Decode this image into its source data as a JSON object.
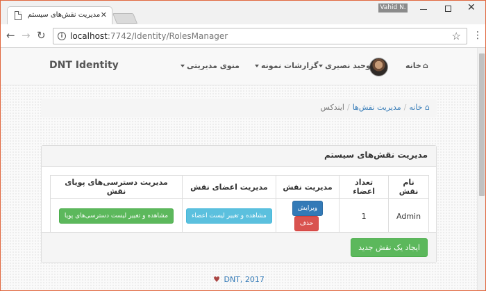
{
  "browser": {
    "tab_title": "مدیریت نقش‌های سیستم",
    "user_badge": "Vahid N.",
    "url_host": "localhost",
    "url_rest": ":7742/Identity/RolesManager"
  },
  "navbar": {
    "brand": "DNT Identity",
    "home": "خانه",
    "user_name": "وحید نصیری",
    "reports": "گزارشات نمونه",
    "admin_menu": "منوی مدیریتی"
  },
  "breadcrumb": {
    "home": "خانه",
    "roles": "مدیریت نقش‌ها",
    "current": "ایندکس"
  },
  "panel": {
    "title": "مدیریت نقش‌های سیستم",
    "new_role_button": "ایجاد یک نقش جدید"
  },
  "table": {
    "headers": [
      "نام نقش",
      "تعداد اعضاء",
      "مدیریت نقش",
      "مدیریت اعضای نقش",
      "مدیریت دسترسی‌های پویای نقش"
    ],
    "rows": [
      {
        "name": "Admin",
        "members": "1",
        "edit": "ویرایش",
        "delete": "حذف",
        "members_button": "مشاهده و تغییر لیست اعضاء",
        "access_button": "مشاهده و تغییر لیست دسترسی‌های پویا"
      }
    ]
  },
  "footer": {
    "text": "DNT, 2017"
  },
  "colors": {
    "window_border": "#e0663d",
    "link": "#337ab7",
    "primary": "#337ab7",
    "danger": "#d9534f",
    "info": "#5bc0de",
    "success": "#5cb85c",
    "heart": "#a94442"
  }
}
